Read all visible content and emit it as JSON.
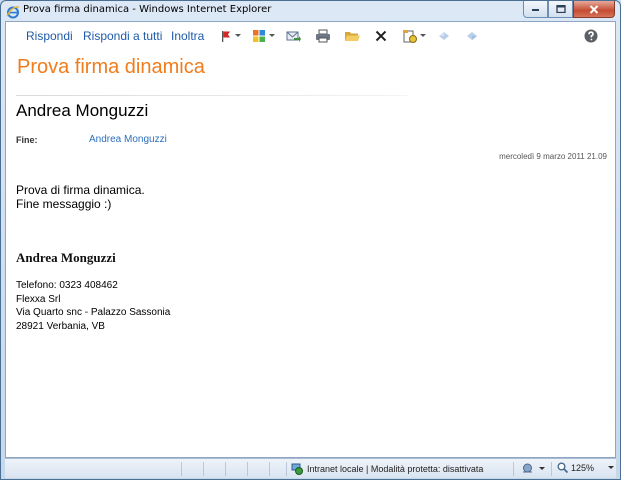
{
  "window": {
    "title": "Prova firma dinamica - Windows Internet Explorer"
  },
  "toolbar": {
    "reply_label": "Rispondi",
    "reply_all_label": "Rispondi a tutti",
    "forward_label": "Inoltra",
    "icons": [
      "flag-icon",
      "categories-icon",
      "move-to-folder-icon",
      "print-icon",
      "open-folder-icon",
      "delete-icon",
      "junk-mail-icon",
      "previous-item-icon",
      "next-item-icon",
      "help-icon"
    ]
  },
  "message": {
    "subject": "Prova firma dinamica",
    "sender": "Andrea Monguzzi",
    "to_label": "Fine:",
    "to_value": "Andrea Monguzzi",
    "date": "mercoledì 9 marzo 2011 21.09",
    "body": [
      "Prova di firma dinamica.",
      "Fine messaggio :)"
    ],
    "signature": {
      "name": "Andrea Monguzzi",
      "lines": [
        "Telefono: 0323 408462",
        "Flexxa Srl",
        "Via Quarto snc - Palazzo Sassonia",
        "28921 Verbania, VB"
      ]
    }
  },
  "statusbar": {
    "zone": "Intranet locale | Modalità protetta: disattivata",
    "zoom": "125%"
  },
  "colors": {
    "subject": "#f07c1c",
    "link": "#1f5aa8"
  }
}
